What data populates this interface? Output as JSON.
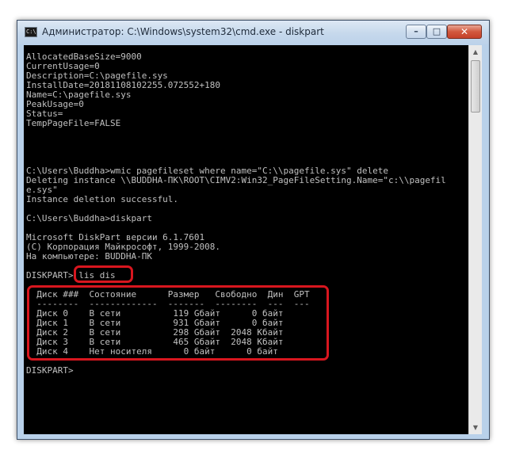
{
  "window": {
    "title": "Администратор: C:\\Windows\\system32\\cmd.exe - diskpart",
    "app_icon_text": "C:\\",
    "buttons": {
      "minimize": "–",
      "maximize": "□",
      "close": "✕"
    }
  },
  "scrollbar": {
    "up_arrow": "▲",
    "down_arrow": "▼"
  },
  "console": {
    "lines": [
      "AllocatedBaseSize=9000",
      "CurrentUsage=0",
      "Description=C:\\pagefile.sys",
      "InstallDate=20181108102255.072552+180",
      "Name=C:\\pagefile.sys",
      "PeakUsage=0",
      "Status=",
      "TempPageFile=FALSE",
      "",
      "",
      "",
      "",
      "C:\\Users\\Buddha>wmic pagefileset where name=\"C:\\\\pagefile.sys\" delete",
      "Deleting instance \\\\BUDDHA-ПК\\ROOT\\CIMV2:Win32_PageFileSetting.Name=\"c:\\\\pagefil",
      "e.sys\"",
      "Instance deletion successful.",
      "",
      "C:\\Users\\Buddha>diskpart",
      "",
      "Microsoft DiskPart версии 6.1.7601",
      "(C) Корпорация Майкрософт, 1999-2008.",
      "На компьютере: BUDDHA-ПК",
      "",
      "DISKPART> lis dis",
      "",
      "  Диск ###  Состояние      Размер   Свободно  Дин  GPT",
      "  --------  -------------  -------  --------  ---  ---",
      "  Диск 0    В сети          119 Gбайт      0 байт",
      "  Диск 1    В сети          931 Gбайт      0 байт",
      "  Диск 2    В сети          298 Gбайт  2048 Kбайт",
      "  Диск 3    В сети          465 Gбайт  2048 Kбайт",
      "  Диск 4    Нет носителя      0 байт      0 байт",
      "",
      "DISKPART>"
    ]
  },
  "annotations": {
    "highlight_color": "#d8161f"
  }
}
